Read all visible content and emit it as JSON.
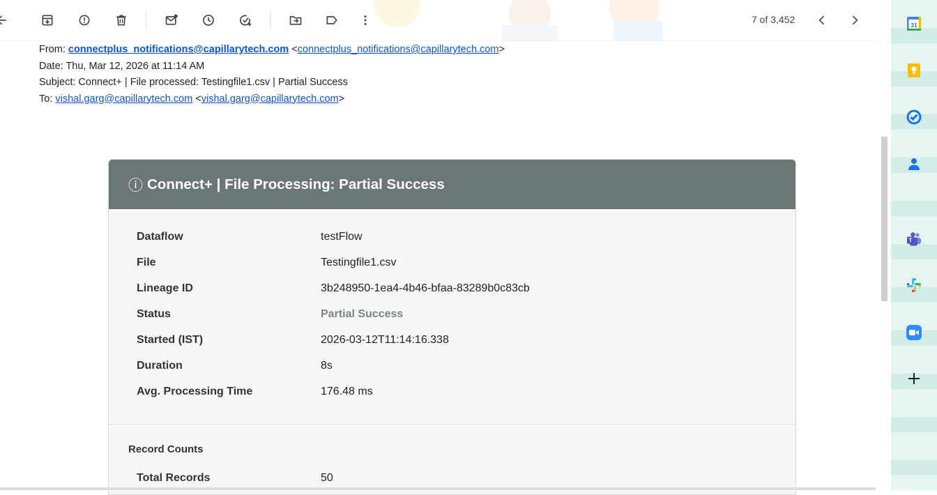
{
  "toolbar": {
    "pager": "7 of 3,452",
    "icons": [
      "back-arrow-icon",
      "archive-icon",
      "report-spam-icon",
      "delete-icon",
      "mark-unread-icon",
      "snooze-icon",
      "add-to-tasks-icon",
      "move-to-icon",
      "label-icon",
      "more-icon",
      "older-chevron-icon",
      "newer-chevron-icon"
    ]
  },
  "email": {
    "from_label": "From:",
    "from_name": "connectplus_notifications@capillarytech.com",
    "from_addr": "connectplus_notifications@capillarytech.com",
    "date_line": "Date: Thu, Mar 12, 2026 at 11:14 AM",
    "subject_line": "Subject: Connect+ | File processed: Testingfile1.csv | Partial Success",
    "to_label": "To:",
    "to_name": "vishal.garg@capillarytech.com",
    "to_addr": "vishal.garg@capillarytech.com"
  },
  "card": {
    "info_glyph": "ⓘ",
    "title": "Connect+ | File Processing: Partial Success",
    "rows": [
      {
        "label": "Dataflow",
        "value": "testFlow"
      },
      {
        "label": "File",
        "value": "Testingfile1.csv"
      },
      {
        "label": "Lineage ID",
        "value": "3b248950-1ea4-4b46-bfaa-83289b0c83cb"
      },
      {
        "label": "Status",
        "value": "Partial Success"
      },
      {
        "label": "Started (IST)",
        "value": "2026-03-12T11:14:16.338"
      },
      {
        "label": "Duration",
        "value": "8s"
      },
      {
        "label": "Avg. Processing Time",
        "value": "176.48 ms"
      }
    ],
    "record_counts_title": "Record Counts",
    "total_records_label": "Total Records",
    "total_records_value": "50"
  },
  "side_panel": {
    "calendar_day": "31",
    "icons": [
      "calendar-icon",
      "keep-icon",
      "tasks-icon",
      "contacts-icon",
      "teams-icon",
      "slack-icon",
      "zoom-icon",
      "add-icon"
    ]
  },
  "colors": {
    "card_header": "#6b7676",
    "status_partial": "#7b8584",
    "link": "#1155cc"
  }
}
